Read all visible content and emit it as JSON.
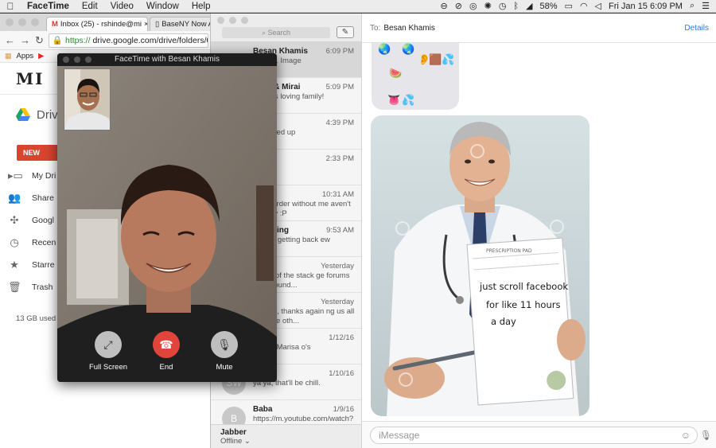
{
  "menubar": {
    "app": "FaceTime",
    "items": [
      "Edit",
      "Video",
      "Window",
      "Help"
    ],
    "battery": "58%",
    "datetime": "Fri Jan 15  6:09 PM"
  },
  "chrome": {
    "tabs": [
      {
        "label": "Inbox (25) - rshinde@mi"
      },
      {
        "label": "BaseNY Now Ac"
      }
    ],
    "url_scheme": "https://",
    "url_rest": "drive.google.com/drive/folders/0",
    "bookmarks": [
      "Apps"
    ],
    "logo": "MI",
    "drive_title": "Drive",
    "new_button": "NEW",
    "sidebar": [
      {
        "label": "My Dri",
        "icon": "drive-folder-icon"
      },
      {
        "label": "Share",
        "icon": "people-icon"
      },
      {
        "label": "Googl",
        "icon": "photos-icon"
      },
      {
        "label": "Recen",
        "icon": "clock-icon"
      },
      {
        "label": "Starre",
        "icon": "star-icon"
      },
      {
        "label": "Trash",
        "icon": "trash-icon"
      }
    ],
    "storage": "13 GB used"
  },
  "messages": {
    "search_placeholder": "Search",
    "conversations": [
      {
        "avatar": "",
        "name": "Besan Khamis",
        "time": "6:09 PM",
        "preview": "ment: 1 Image",
        "selected": true
      },
      {
        "avatar": "",
        "name": "Mom & Mirai",
        "time": "5:09 PM",
        "preview": "physics loving family!"
      },
      {
        "avatar": "",
        "name": "",
        "time": "4:39 PM",
        "preview": "its fucked up"
      },
      {
        "avatar": "",
        "name": "",
        "time": "2:33 PM",
        "preview": ""
      },
      {
        "avatar": "",
        "name": "na",
        "time": "10:31 AM",
        "preview": "way! Order without me aven't already :P"
      },
      {
        "avatar": "",
        "name": "muething",
        "time": "9:53 AM",
        "preview": "ah, I'm getting back ew"
      },
      {
        "avatar": "",
        "name": "",
        "time": "Yesterday",
        "preview": "ah, all of the stack ge forums that I found..."
      },
      {
        "avatar": "",
        "name": "n O",
        "time": "Yesterday",
        "preview": "ol, also, thanks again ng us all over the oth..."
      },
      {
        "avatar": "",
        "name": "",
        "time": "1/12/16",
        "preview": "chill at Marisa o's"
      },
      {
        "avatar": "SW",
        "name": "ang",
        "time": "1/10/16",
        "preview": "ya ya, that'll be chill."
      },
      {
        "avatar": "B",
        "name": "Baba",
        "time": "1/9/16",
        "preview": "https://m.youtube.com/watch?"
      }
    ],
    "account": "Jabber",
    "account_status": "Offline ⌄",
    "to_label": "To:",
    "recipient": "Besan Khamis",
    "details": "Details",
    "emoji_bubble": [
      "🌏",
      "🌏",
      "👂",
      "🟫",
      "💦",
      "🍉",
      "👅",
      "💦"
    ],
    "prescription_header": "PRESCRIPTION PAD",
    "prescription_lines": [
      "just scroll facebook",
      "for like 11 hours",
      "a day"
    ],
    "input_placeholder": "iMessage"
  },
  "facetime": {
    "title": "FaceTime with Besan Khamis",
    "controls": [
      {
        "label": "Full Screen",
        "icon": "fullscreen-icon"
      },
      {
        "label": "End",
        "icon": "end-call-icon"
      },
      {
        "label": "Mute",
        "icon": "mute-icon"
      }
    ]
  }
}
